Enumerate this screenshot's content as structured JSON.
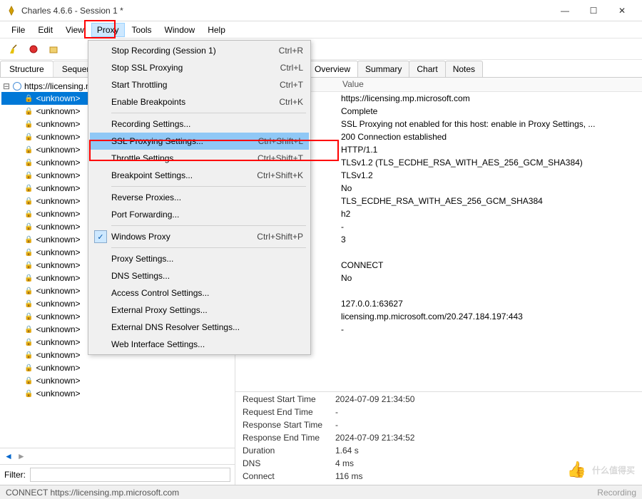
{
  "window": {
    "title": "Charles 4.6.6 - Session 1 *",
    "min": "—",
    "max": "☐",
    "close": "✕"
  },
  "menu": {
    "items": [
      "File",
      "Edit",
      "View",
      "Proxy",
      "Tools",
      "Window",
      "Help"
    ],
    "open_index": 3
  },
  "proxy_menu": [
    {
      "label": "Stop Recording (Session 1)",
      "shortcut": "Ctrl+R"
    },
    {
      "label": "Stop SSL Proxying",
      "shortcut": "Ctrl+L"
    },
    {
      "label": "Start Throttling",
      "shortcut": "Ctrl+T"
    },
    {
      "label": "Enable Breakpoints",
      "shortcut": "Ctrl+K"
    },
    {
      "sep": true
    },
    {
      "label": "Recording Settings..."
    },
    {
      "label": "SSL Proxying Settings...",
      "shortcut": "Ctrl+Shift+L",
      "highlight": true
    },
    {
      "label": "Throttle Settings...",
      "shortcut": "Ctrl+Shift+T"
    },
    {
      "label": "Breakpoint Settings...",
      "shortcut": "Ctrl+Shift+K"
    },
    {
      "sep": true
    },
    {
      "label": "Reverse Proxies..."
    },
    {
      "label": "Port Forwarding..."
    },
    {
      "sep": true
    },
    {
      "label": "Windows Proxy",
      "shortcut": "Ctrl+Shift+P",
      "checked": true
    },
    {
      "sep": true
    },
    {
      "label": "Proxy Settings..."
    },
    {
      "label": "DNS Settings..."
    },
    {
      "label": "Access Control Settings..."
    },
    {
      "label": "External Proxy Settings..."
    },
    {
      "label": "External DNS Resolver Settings..."
    },
    {
      "label": "Web Interface Settings..."
    }
  ],
  "left_tabs": [
    "Structure",
    "Sequence"
  ],
  "tree": {
    "root": "https://licensing.mp.microsoft.com",
    "item_label": "<unknown>",
    "count": 24,
    "selected_index": 0
  },
  "filter": {
    "label": "Filter:",
    "value": ""
  },
  "right_tabs": [
    "Overview",
    "Summary",
    "Chart",
    "Notes"
  ],
  "detail_header": "Value",
  "values": [
    "https://licensing.mp.microsoft.com",
    "Complete",
    "SSL Proxying not enabled for this host: enable in Proxy Settings, ...",
    "200 Connection established",
    "HTTP/1.1",
    "TLSv1.2 (TLS_ECDHE_RSA_WITH_AES_256_GCM_SHA384)",
    "TLSv1.2",
    "No",
    "TLS_ECDHE_RSA_WITH_AES_256_GCM_SHA384",
    "h2",
    "-",
    "3",
    "",
    "CONNECT",
    "No",
    "",
    "127.0.0.1:63627",
    "licensing.mp.microsoft.com/20.247.184.197:443",
    "-"
  ],
  "timing": [
    {
      "label": "Request Start Time",
      "value": "2024-07-09 21:34:50"
    },
    {
      "label": "Request End Time",
      "value": "-"
    },
    {
      "label": "Response Start Time",
      "value": "-"
    },
    {
      "label": "Response End Time",
      "value": "2024-07-09 21:34:52"
    },
    {
      "label": "Duration",
      "value": "1.64 s"
    },
    {
      "label": "DNS",
      "value": "4 ms"
    },
    {
      "label": "Connect",
      "value": "116 ms"
    }
  ],
  "status": {
    "left": "CONNECT https://licensing.mp.microsoft.com",
    "right": "Recording"
  },
  "watermark": "什么值得买",
  "nav": {
    "prev": "◄",
    "next": "►"
  }
}
